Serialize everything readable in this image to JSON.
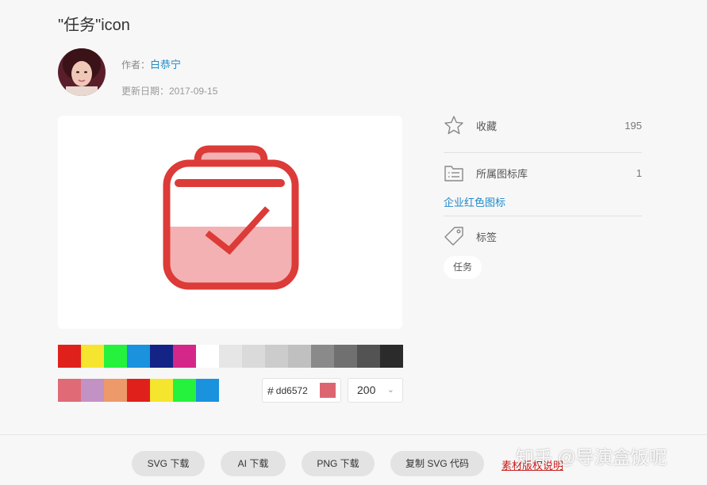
{
  "header": {
    "title": "\"任务\"icon"
  },
  "author": {
    "label": "作者：",
    "name": "白恭宁",
    "updated": "更新日期：2017-09-15"
  },
  "preview": {
    "icon": "task-bag-check-icon",
    "color": "#dd6572"
  },
  "palette": {
    "row1": [
      "#e0201b",
      "#f5e52e",
      "#24f23c",
      "#1a92de",
      "#132486",
      "#d5278a",
      "#ffffff",
      "#e6e6e6",
      "#dadada",
      "#cccccc",
      "#c0c0c0",
      "#8a8a8a",
      "#707070",
      "#535353",
      "#2b2b2b"
    ],
    "row2": [
      "#e06b77",
      "#c292c4",
      "#ee9969",
      "#e0201b",
      "#f5e52e",
      "#24f23c",
      "#1a92de"
    ]
  },
  "color_input": {
    "hash": "#",
    "value": "dd6572",
    "chip": "#dd6572"
  },
  "size_select": {
    "value": "200",
    "caret": "⌄"
  },
  "sidebar": {
    "favorites_label": "收藏",
    "favorites_count": "195",
    "library_label": "所属图标库",
    "library_count": "1",
    "library_name": "企业红色图标",
    "tags_label": "标签",
    "tag": "任务"
  },
  "footer": {
    "svg": "SVG 下载",
    "ai": "AI 下载",
    "png": "PNG 下载",
    "copy_svg": "复制 SVG 代码",
    "copyright": "素材版权说明",
    "watermark": "知乎 @导演盒饭呢"
  }
}
